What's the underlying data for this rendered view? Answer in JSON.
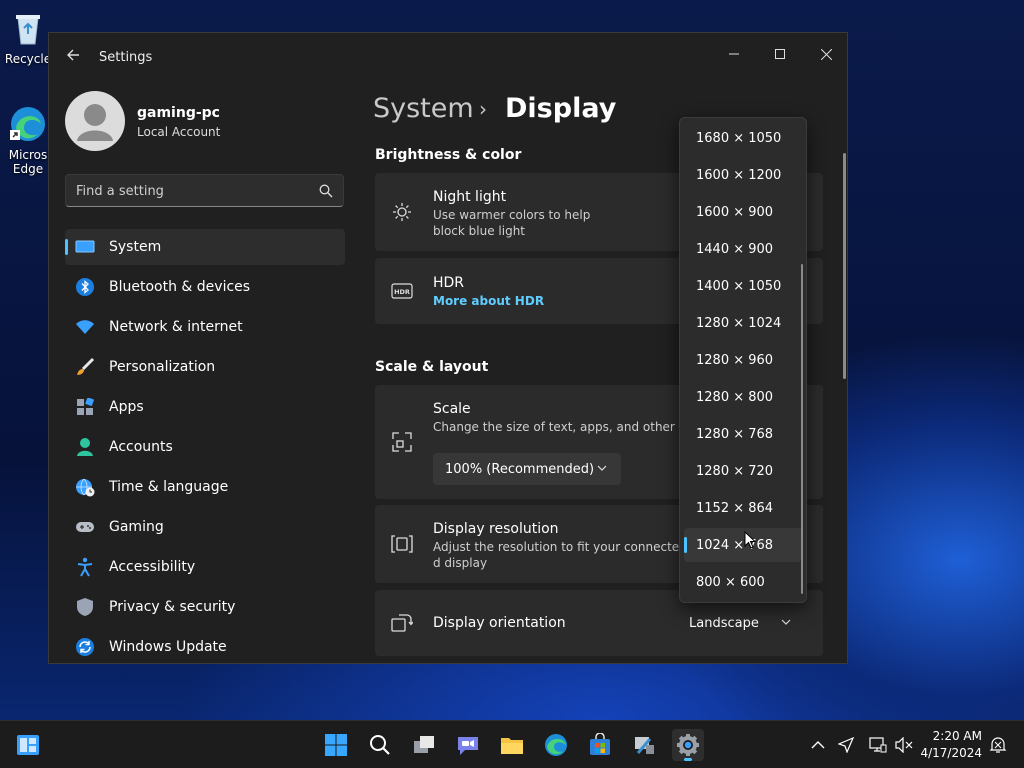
{
  "desktop": {
    "recycle_label": "Recycle",
    "edge_label_1": "Micros",
    "edge_label_2": "Edge"
  },
  "window": {
    "title": "Settings"
  },
  "account": {
    "name": "gaming-pc",
    "type": "Local Account"
  },
  "search": {
    "placeholder": "Find a setting"
  },
  "nav": {
    "items": [
      {
        "label": "System",
        "icon": "monitor-icon"
      },
      {
        "label": "Bluetooth & devices",
        "icon": "bluetooth-icon"
      },
      {
        "label": "Network & internet",
        "icon": "wifi-icon"
      },
      {
        "label": "Personalization",
        "icon": "brush-icon"
      },
      {
        "label": "Apps",
        "icon": "apps-icon"
      },
      {
        "label": "Accounts",
        "icon": "person-icon"
      },
      {
        "label": "Time & language",
        "icon": "globe-clock-icon"
      },
      {
        "label": "Gaming",
        "icon": "gamepad-icon"
      },
      {
        "label": "Accessibility",
        "icon": "accessibility-icon"
      },
      {
        "label": "Privacy & security",
        "icon": "shield-icon"
      },
      {
        "label": "Windows Update",
        "icon": "update-icon"
      }
    ],
    "active_index": 0
  },
  "breadcrumb": {
    "parent": "System",
    "separator": "›",
    "current": "Display"
  },
  "sections": {
    "brightness": "Brightness & color",
    "scale_layout": "Scale & layout"
  },
  "cards": {
    "night_light": {
      "title": "Night light",
      "sub_1": "Use warmer colors to help",
      "sub_2": "block blue light"
    },
    "hdr": {
      "title": "HDR",
      "link": "More about HDR"
    },
    "scale": {
      "title": "Scale",
      "sub": "Change the size of text, apps, and other items",
      "value": "100% (Recommended)"
    },
    "resolution": {
      "title": "Display resolution",
      "sub_1": "Adjust the resolution to fit your connecte",
      "sub_2": "d display"
    },
    "orientation": {
      "title": "Display orientation",
      "value": "Landscape"
    }
  },
  "resolution_options": [
    "1680 × 1050",
    "1600 × 1200",
    "1600 × 900",
    "1440 × 900",
    "1400 × 1050",
    "1280 × 1024",
    "1280 × 960",
    "1280 × 800",
    "1280 × 768",
    "1280 × 720",
    "1152 × 864",
    "1024 × 768",
    "800 × 600"
  ],
  "resolution_selected_index": 11,
  "taskbar": {
    "time": "2:20 AM",
    "date": "4/17/2024"
  },
  "colors": {
    "accent": "#4cc2ff",
    "link": "#60cdff",
    "window_bg": "#202020",
    "card_bg": "#2b2b2b"
  }
}
